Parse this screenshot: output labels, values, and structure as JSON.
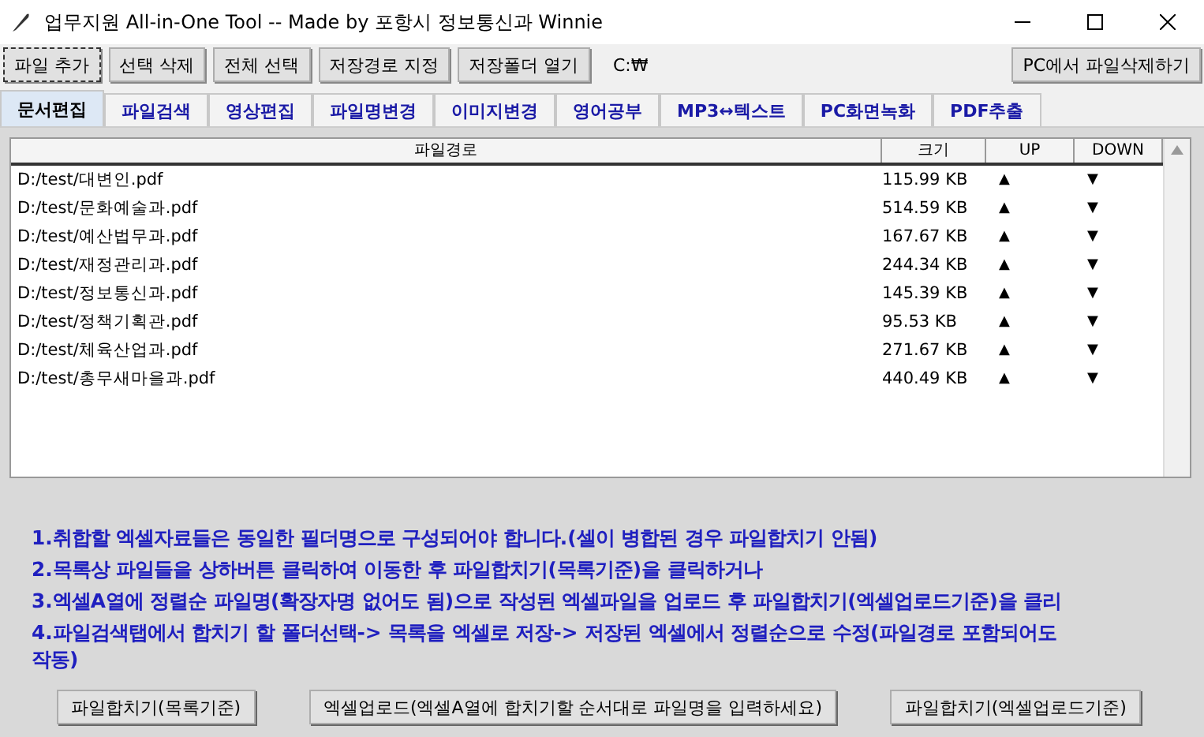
{
  "window": {
    "title": "업무지원 All-in-One Tool -- Made by 포항시 정보통신과 Winnie"
  },
  "toolbar": {
    "buttons": [
      {
        "label": "파일 추가",
        "focused": true
      },
      {
        "label": "선택 삭제",
        "focused": false
      },
      {
        "label": "전체 선택",
        "focused": false
      },
      {
        "label": "저장경로 지정",
        "focused": false
      },
      {
        "label": "저장폴더 열기",
        "focused": false
      }
    ],
    "path": "C:₩",
    "right_button": "PC에서 파일삭제하기"
  },
  "tabs": [
    {
      "label": "문서편집",
      "selected": true
    },
    {
      "label": "파일검색",
      "selected": false
    },
    {
      "label": "영상편집",
      "selected": false
    },
    {
      "label": "파일명변경",
      "selected": false
    },
    {
      "label": "이미지변경",
      "selected": false
    },
    {
      "label": "영어공부",
      "selected": false
    },
    {
      "label": "MP3↔텍스트",
      "selected": false
    },
    {
      "label": "PC화면녹화",
      "selected": false
    },
    {
      "label": "PDF추출",
      "selected": false
    }
  ],
  "table": {
    "columns": [
      "파일경로",
      "크기",
      "UP",
      "DOWN"
    ],
    "rows": [
      {
        "path": "D:/test/대변인.pdf",
        "size": "115.99 KB",
        "up": "▲",
        "down": "▼"
      },
      {
        "path": "D:/test/문화예술과.pdf",
        "size": "514.59 KB",
        "up": "▲",
        "down": "▼"
      },
      {
        "path": "D:/test/예산법무과.pdf",
        "size": "167.67 KB",
        "up": "▲",
        "down": "▼"
      },
      {
        "path": "D:/test/재정관리과.pdf",
        "size": "244.34 KB",
        "up": "▲",
        "down": "▼"
      },
      {
        "path": "D:/test/정보통신과.pdf",
        "size": "145.39 KB",
        "up": "▲",
        "down": "▼"
      },
      {
        "path": "D:/test/정책기획관.pdf",
        "size": "95.53 KB",
        "up": "▲",
        "down": "▼"
      },
      {
        "path": "D:/test/체육산업과.pdf",
        "size": "271.67 KB",
        "up": "▲",
        "down": "▼"
      },
      {
        "path": "D:/test/총무새마을과.pdf",
        "size": "440.49 KB",
        "up": "▲",
        "down": "▼"
      }
    ]
  },
  "instructions": [
    "1.취합할 엑셀자료들은 동일한 필더명으로 구성되어야 합니다.(셀이 병합된 경우 파일합치기 안됨)",
    "2.목록상 파일들을 상하버튼 클릭하여 이동한 후 파일합치기(목록기준)을 클릭하거나",
    "3.엑셀A열에 정렬순 파일명(확장자명 없어도 됨)으로 작성된 엑셀파일을 업로드 후 파일합치기(엑셀업로드기준)을 클리",
    "4.파일검색탭에서 합치기 할 폴더선택-> 목록을 엑셀로 저장-> 저장된 엑셀에서 정렬순으로 수정(파일경로 포함되어도 작동)"
  ],
  "bottom_buttons": [
    "파일합치기(목록기준)",
    "엑셀업로드(엑셀A열에 합치기할 순서대로 파일명을 입력하세요)",
    "파일합치기(엑셀업로드기준)"
  ]
}
